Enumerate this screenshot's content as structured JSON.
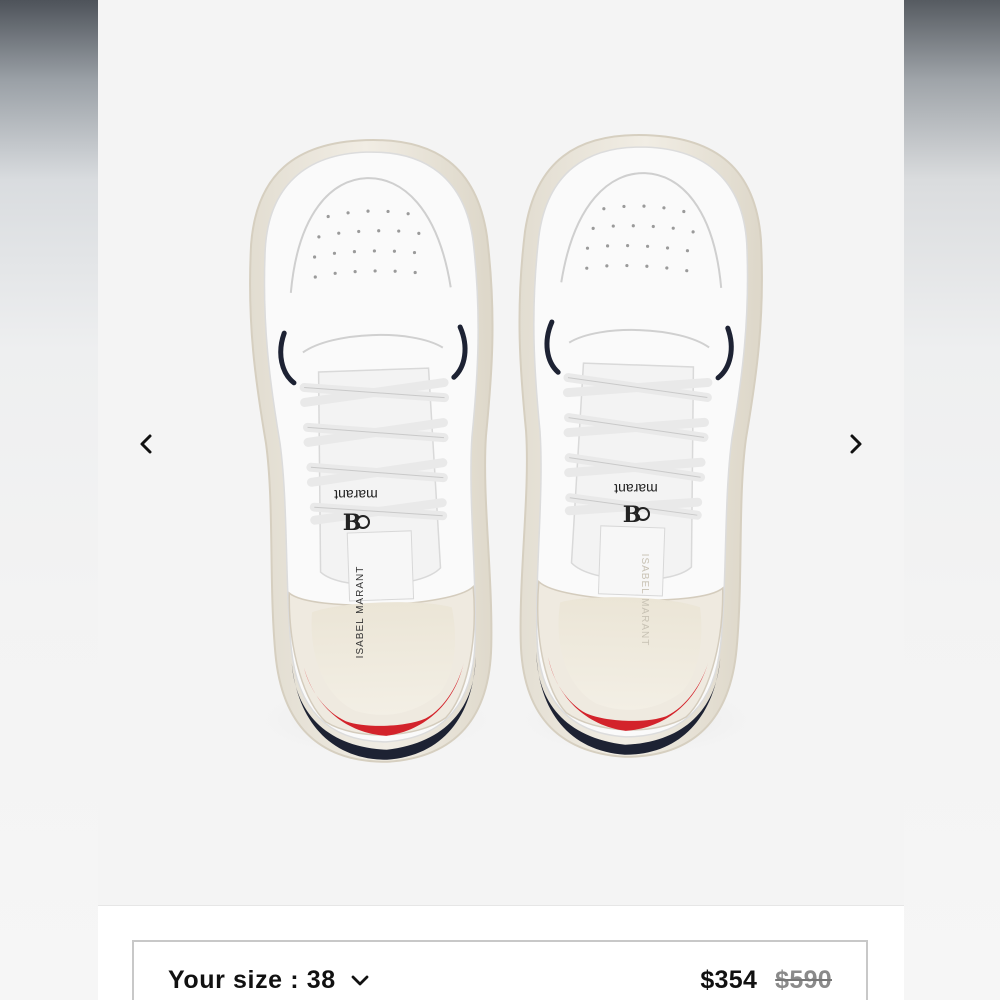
{
  "gallery": {
    "product_image_alt": "Isabel Marant white leather sneakers, top view",
    "insole_brand": "ISABEL MARANT",
    "tongue_brand": "marant",
    "prev_icon": "chevron-left-icon",
    "next_icon": "chevron-right-icon"
  },
  "purchase": {
    "size_label": "Your size : 38",
    "size_icon": "chevron-down-icon",
    "price_current": "$354",
    "price_original": "$590"
  },
  "colors": {
    "heel_red": "#d3232b",
    "heel_navy": "#1d2233",
    "leather_white": "#f7f7f5"
  }
}
